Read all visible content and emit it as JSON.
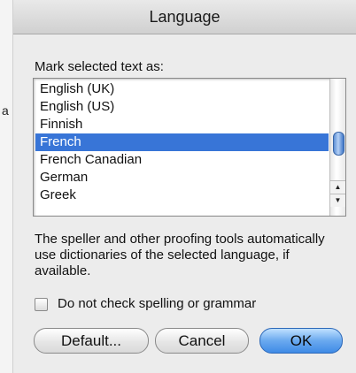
{
  "window": {
    "title": "Language"
  },
  "background": {
    "stray_char": "a"
  },
  "prompt": "Mark selected text as:",
  "languages": {
    "items": [
      "English (UK)",
      "English (US)",
      "Finnish",
      "French",
      "French Canadian",
      "German",
      "Greek"
    ],
    "selected": "French"
  },
  "description": "The speller and other proofing tools automatically use dictionaries of the selected language, if available.",
  "checkbox": {
    "label": "Do not check spelling or grammar",
    "checked": false
  },
  "buttons": {
    "default_label": "Default...",
    "cancel_label": "Cancel",
    "ok_label": "OK"
  },
  "colors": {
    "selection": "#3875d7",
    "default_button": "#3f8be6"
  }
}
